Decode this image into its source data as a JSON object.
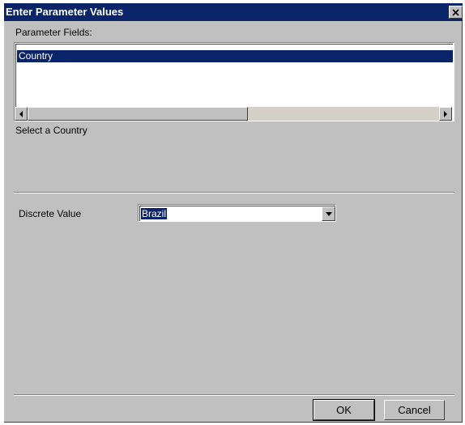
{
  "window": {
    "title": "Enter Parameter Values",
    "close_glyph": "✕"
  },
  "parameters": {
    "label": "Parameter Fields:",
    "selected_item": "Country",
    "prompt": "Select a Country"
  },
  "value": {
    "label": "Discrete Value",
    "selected": "Brazil"
  },
  "buttons": {
    "ok": "OK",
    "cancel": "Cancel"
  },
  "colors": {
    "title_bar": "#0a246a",
    "dialog_face": "#c0c0c0",
    "selection": "#0a246a"
  }
}
